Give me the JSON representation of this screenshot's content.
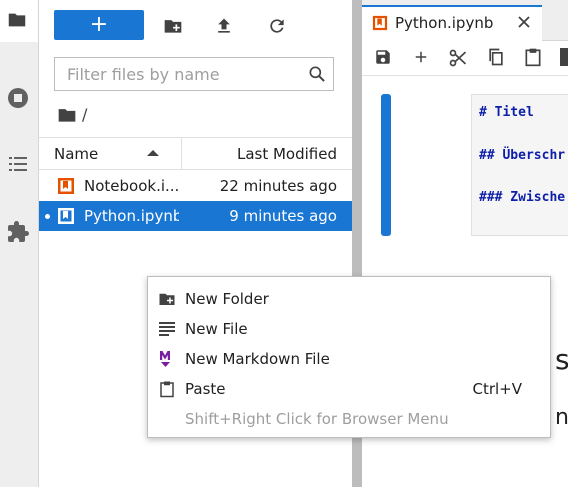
{
  "activity_bar": {
    "icons": [
      "folder-icon",
      "running-icon",
      "toc-icon",
      "extension-icon"
    ]
  },
  "file_browser": {
    "new_button_label": "+",
    "toolbar_icons": [
      "new-folder-icon",
      "upload-icon",
      "refresh-icon"
    ],
    "filter_placeholder": "Filter files by name",
    "breadcrumb": "/",
    "columns": {
      "name": "Name",
      "modified": "Last Modified"
    },
    "sort_indicator": "ascending",
    "files": [
      {
        "name": "Notebook.i...",
        "modified": "22 minutes ago",
        "selected": false,
        "running": false
      },
      {
        "name": "Python.ipynb",
        "modified": "9 minutes ago",
        "selected": true,
        "running": true
      }
    ]
  },
  "notebook": {
    "tab_title": "Python.ipynb",
    "toolbar_icons": [
      "save-icon",
      "add-icon",
      "cut-icon",
      "copy-icon",
      "paste-icon"
    ],
    "cell_lines": [
      "# Titel",
      "## Überschr",
      "### Zwische"
    ],
    "rendered_fragments": [
      "sc",
      "ne"
    ]
  },
  "context_menu": {
    "items": [
      {
        "label": "New Folder",
        "icon": "new-folder-icon",
        "shortcut": ""
      },
      {
        "label": "New File",
        "icon": "text-file-icon",
        "shortcut": ""
      },
      {
        "label": "New Markdown File",
        "icon": "markdown-icon",
        "shortcut": ""
      },
      {
        "label": "Paste",
        "icon": "paste-icon",
        "shortcut": "Ctrl+V"
      },
      {
        "label": "Shift+Right Click for Browser Menu",
        "icon": "",
        "shortcut": "",
        "disabled": true
      }
    ]
  },
  "colors": {
    "accent": "#1976d2",
    "notebook_icon": "#e65100",
    "markdown_icon": "#7b1fa2",
    "code_text": "#0d1ea8"
  }
}
